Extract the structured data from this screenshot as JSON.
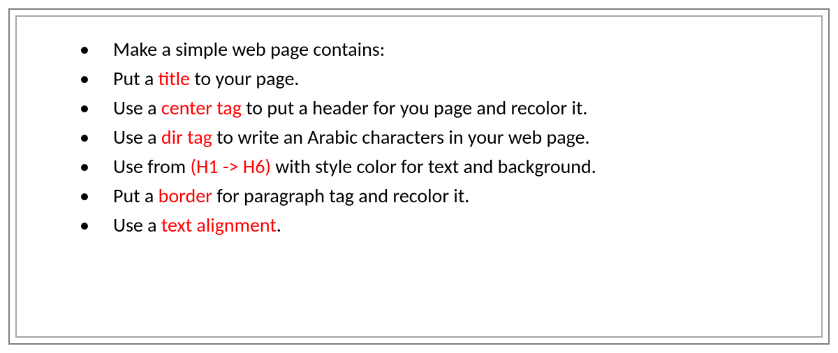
{
  "items": [
    {
      "segments": [
        {
          "t": "Make a simple web page contains:"
        }
      ]
    },
    {
      "segments": [
        {
          "t": "Put a "
        },
        {
          "t": "title",
          "hl": true
        },
        {
          "t": " to your page."
        }
      ]
    },
    {
      "segments": [
        {
          "t": "Use a "
        },
        {
          "t": "center tag",
          "hl": true
        },
        {
          "t": " to put a header for you page and recolor it."
        }
      ]
    },
    {
      "segments": [
        {
          "t": "Use a "
        },
        {
          "t": "dir tag",
          "hl": true
        },
        {
          "t": " to write an Arabic characters in your web page."
        }
      ]
    },
    {
      "segments": [
        {
          "t": "Use from "
        },
        {
          "t": "(H1 -> H6)",
          "hl": true
        },
        {
          "t": " with style color for text and background."
        }
      ]
    },
    {
      "segments": [
        {
          "t": "Put a "
        },
        {
          "t": "border",
          "hl": true
        },
        {
          "t": " for paragraph tag and recolor it."
        }
      ]
    },
    {
      "segments": [
        {
          "t": "Use a "
        },
        {
          "t": "text alignment",
          "hl": true
        },
        {
          "t": "."
        }
      ]
    }
  ]
}
